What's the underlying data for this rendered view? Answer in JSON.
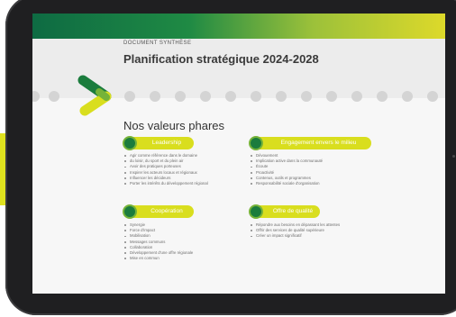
{
  "document": {
    "subtitle": "DOCUMENT SYNTHÈSE",
    "title": "Planification stratégique 2024-2028",
    "section_title": "Nos valeurs phares"
  },
  "colors": {
    "dark_green": "#1b7c3d",
    "light_green": "#76b339",
    "yellow": "#d9de1e",
    "dot_grey": "#d4d4d4"
  },
  "values": [
    {
      "label": "Leadership",
      "items": [
        "Agir comme référence dans le domaine",
        "du loisir, du sport et du plein air",
        "Avoir des pratiques porteuses",
        "Inspirer les acteurs locaux et régionaux",
        "Influencer les décideurs",
        "Porter les intérêts du développement régional"
      ]
    },
    {
      "label": "Engagement envers le milieu",
      "items": [
        "Dévouement",
        "Implication active dans la communauté",
        "Écoute",
        "Proactivité",
        "Contenus, outils et programmes",
        "Responsabilité sociale d'organisation"
      ]
    },
    {
      "label": "Coopération",
      "items": [
        "Synergie",
        "Force d'impact",
        "Mobilisation",
        "Messages communs",
        "Collaboration",
        "Développement d'une offre régionale",
        "Mise en commun"
      ]
    },
    {
      "label": "Offre de qualité",
      "items": [
        "Répondre aux besoins en dépassant les attentes",
        "Offrir des services de qualité supérieure",
        "Créer un impact significatif"
      ]
    }
  ]
}
